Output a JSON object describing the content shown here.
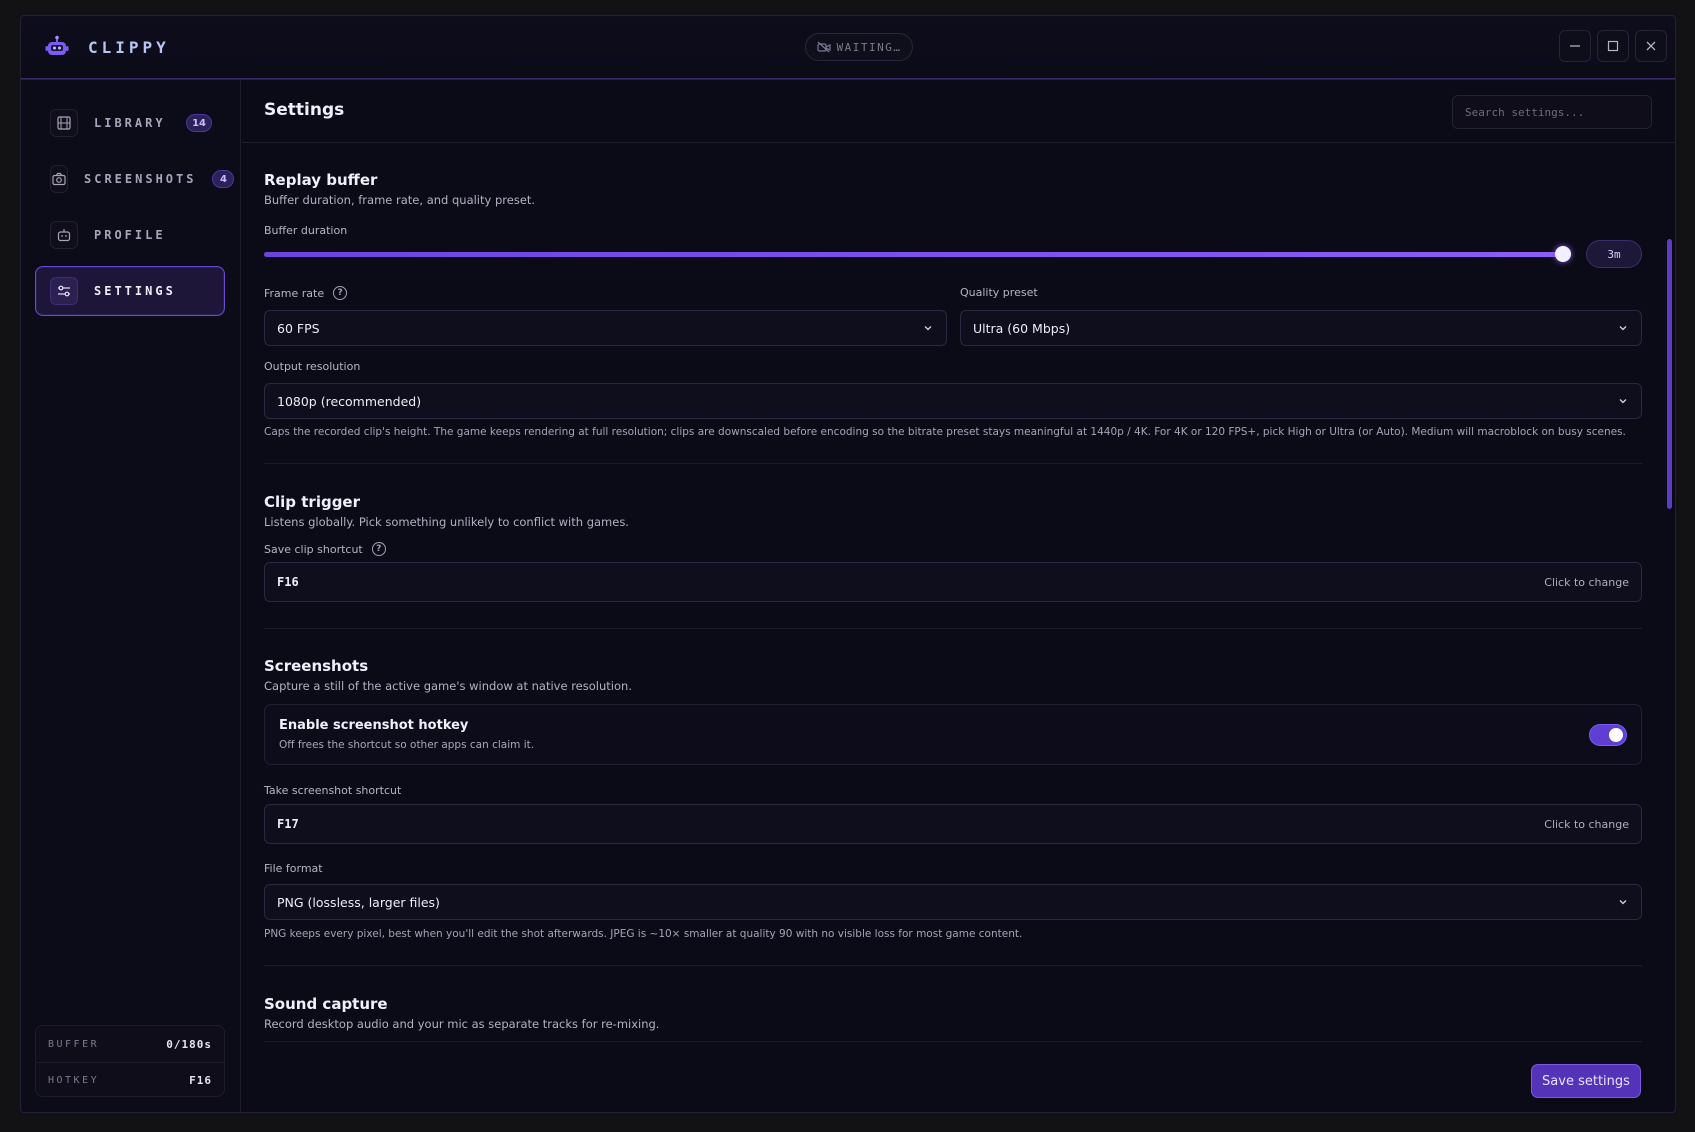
{
  "app": {
    "name": "CLIPPY",
    "status": "WAITING…"
  },
  "sidebar": {
    "items": [
      {
        "label": "LIBRARY",
        "badge": "14",
        "icon": "film-icon"
      },
      {
        "label": "SCREENSHOTS",
        "badge": "4",
        "icon": "camera-icon"
      },
      {
        "label": "PROFILE",
        "badge": "",
        "icon": "robot-icon"
      },
      {
        "label": "SETTINGS",
        "badge": "",
        "icon": "sliders-icon",
        "active": true
      }
    ],
    "footer": {
      "buffer_label": "BUFFER",
      "buffer_value": "0/180s",
      "hotkey_label": "HOTKEY",
      "hotkey_value": "F16"
    }
  },
  "header": {
    "title": "Settings",
    "search_placeholder": "Search settings..."
  },
  "replay": {
    "title": "Replay buffer",
    "desc": "Buffer duration, frame rate, and quality preset.",
    "duration_label": "Buffer duration",
    "duration_value": "3m",
    "duration_fraction": 0.994,
    "framerate_label": "Frame rate",
    "framerate_value": "60 FPS",
    "quality_label": "Quality preset",
    "quality_value": "Ultra (60 Mbps)",
    "resolution_label": "Output resolution",
    "resolution_value": "1080p (recommended)",
    "resolution_hint": "Caps the recorded clip's height. The game keeps rendering at full resolution; clips are downscaled before encoding so the bitrate preset stays meaningful at 1440p / 4K. For 4K or 120 FPS+, pick High or Ultra (or Auto). Medium will macroblock on busy scenes."
  },
  "trigger": {
    "title": "Clip trigger",
    "desc": "Listens globally. Pick something unlikely to conflict with games.",
    "shortcut_label": "Save clip shortcut",
    "shortcut_value": "F16",
    "change_label": "Click to change"
  },
  "screenshots": {
    "title": "Screenshots",
    "desc": "Capture a still of the active game's window at native resolution.",
    "enable_title": "Enable screenshot hotkey",
    "enable_desc": "Off frees the shortcut so other apps can claim it.",
    "enabled": true,
    "shortcut_label": "Take screenshot shortcut",
    "shortcut_value": "F17",
    "change_label": "Click to change",
    "format_label": "File format",
    "format_value": "PNG (lossless, larger files)",
    "format_hint": "PNG keeps every pixel, best when you'll edit the shot afterwards. JPEG is ~10× smaller at quality 90 with no visible loss for most game content."
  },
  "sound": {
    "title": "Sound capture",
    "desc": "Record desktop audio and your mic as separate tracks for re-mixing."
  },
  "actions": {
    "save_label": "Save settings"
  },
  "colors": {
    "accent": "#6b44e0",
    "background": "#0b0b17",
    "brand": "#b9c4f5"
  }
}
